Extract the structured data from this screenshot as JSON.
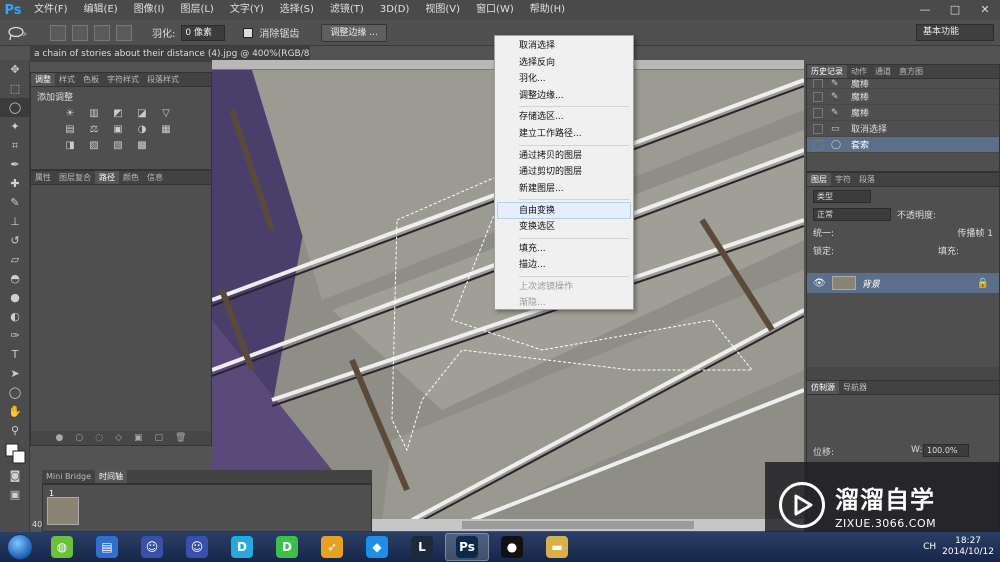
{
  "app": {
    "logo": "Ps",
    "menus": [
      "文件(F)",
      "编辑(E)",
      "图像(I)",
      "图层(L)",
      "文字(Y)",
      "选择(S)",
      "滤镜(T)",
      "3D(D)",
      "视图(V)",
      "窗口(W)",
      "帮助(H)"
    ],
    "window_controls": [
      "—",
      "□",
      "✕"
    ]
  },
  "options": {
    "feather_label": "羽化:",
    "feather_value": "0 像素",
    "antialias_label": "消除锯齿",
    "refine_button": "调整边缘 ...",
    "workspace": "基本功能"
  },
  "document": {
    "tab_title": "a chain of stories about their distance (4).jpg @ 400%(RGB/8#) *",
    "zoom": "40"
  },
  "adjustments": {
    "tabs": [
      "调整",
      "样式",
      "色板",
      "字符样式",
      "段落样式"
    ],
    "title": "添加调整",
    "icons_row1": [
      "☀",
      "▥",
      "◩",
      "◪",
      "▽"
    ],
    "icons_row2": [
      "▤",
      "⚖",
      "▣",
      "◑",
      "▦"
    ],
    "icons_row3": [
      "◨",
      "▨",
      "▧",
      "▩"
    ]
  },
  "paths": {
    "tabs": [
      "属性",
      "图层复合",
      "路径",
      "颜色",
      "信息"
    ],
    "footer": [
      "●",
      "○",
      "◌",
      "◇",
      "▣",
      "▢",
      "🗑"
    ]
  },
  "bridge": {
    "tabs": [
      "Mini Bridge",
      "时间轴"
    ],
    "frame_number": "1"
  },
  "history": {
    "tabs": [
      "历史记录",
      "动作",
      "通道",
      "直方图"
    ],
    "items": [
      {
        "label": "魔棒",
        "icon": "✎"
      },
      {
        "label": "魔棒",
        "icon": "✎"
      },
      {
        "label": "魔棒",
        "icon": "✎"
      },
      {
        "label": "取消选择",
        "icon": "▭"
      },
      {
        "label": "套索",
        "icon": "◯"
      }
    ]
  },
  "layers": {
    "tabs": [
      "图层",
      "字符",
      "段落"
    ],
    "kind": "类型",
    "blend": "正常",
    "opacity_label": "不透明度:",
    "unify_label": "统一:",
    "propagate_label": "传播帧 1",
    "lock_label": "锁定:",
    "fill_label": "填充:",
    "layer_name": "背景"
  },
  "clone": {
    "tabs": [
      "仿制源",
      "导航器"
    ],
    "offset_label": "位移:",
    "w_label": "W:",
    "w_value": "100.0%"
  },
  "context_menu": [
    {
      "label": "取消选择",
      "state": "normal"
    },
    {
      "label": "选择反向",
      "state": "normal"
    },
    {
      "label": "羽化...",
      "state": "normal"
    },
    {
      "label": "调整边缘...",
      "state": "normal"
    },
    {
      "sep": true
    },
    {
      "label": "存储选区...",
      "state": "normal"
    },
    {
      "label": "建立工作路径...",
      "state": "normal"
    },
    {
      "sep": true
    },
    {
      "label": "通过拷贝的图层",
      "state": "normal"
    },
    {
      "label": "通过剪切的图层",
      "state": "normal"
    },
    {
      "label": "新建图层...",
      "state": "normal"
    },
    {
      "sep": true
    },
    {
      "label": "自由变换",
      "state": "hover"
    },
    {
      "label": "变换选区",
      "state": "normal"
    },
    {
      "sep": true
    },
    {
      "label": "填充...",
      "state": "normal"
    },
    {
      "label": "描边...",
      "state": "normal"
    },
    {
      "sep": true
    },
    {
      "label": "上次滤镜操作",
      "state": "disabled"
    },
    {
      "label": "渐隐...",
      "state": "disabled"
    }
  ],
  "taskbar": {
    "apps": [
      {
        "name": "360",
        "glyph": "◍",
        "color": "#6cc03a"
      },
      {
        "name": "files",
        "glyph": "▤",
        "color": "#2f6fd0"
      },
      {
        "name": "anime1",
        "glyph": "☺",
        "color": "#3a4fa8"
      },
      {
        "name": "anime2",
        "glyph": "☺",
        "color": "#3a4fa8"
      },
      {
        "name": "d-app",
        "glyph": "D",
        "color": "#28a8e0"
      },
      {
        "name": "d-app2",
        "glyph": "D",
        "color": "#3cbf4a"
      },
      {
        "name": "bird",
        "glyph": "➶",
        "color": "#e8a020"
      },
      {
        "name": "browser",
        "glyph": "◆",
        "color": "#1e8fe8"
      },
      {
        "name": "lol",
        "glyph": "L",
        "color": "#1c2a3a"
      },
      {
        "name": "photoshop",
        "glyph": "Ps",
        "color": "#0b2a4a",
        "active": true
      },
      {
        "name": "qq",
        "glyph": "●",
        "color": "#111"
      },
      {
        "name": "explorer",
        "glyph": "▬",
        "color": "#d8b04a"
      }
    ],
    "tray_lang": "CH",
    "time": "18:27",
    "date": "2014/10/12"
  },
  "watermark": {
    "title": "溜溜自学",
    "url": "ZIXUE.3066.COM"
  },
  "colors": {
    "accent_blue": "#5b6f8a",
    "ps_blue": "#2fa7ff"
  }
}
